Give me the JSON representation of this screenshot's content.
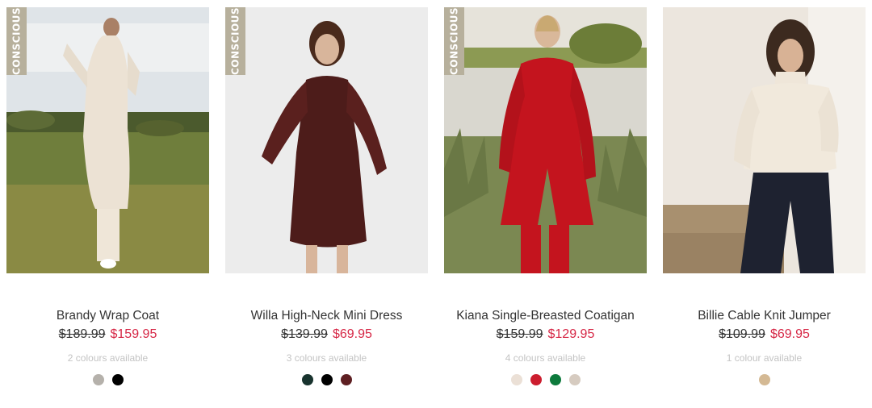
{
  "products": [
    {
      "badge": "CONSCIOUS",
      "name": "Brandy Wrap Coat",
      "was_price": "$189.99",
      "now_price": "$159.95",
      "colours_text": "2 colours available",
      "swatches": [
        "#b5b1ab",
        "#000000"
      ]
    },
    {
      "badge": "CONSCIOUS",
      "name": "Willa High-Neck Mini Dress",
      "was_price": "$139.99",
      "now_price": "$69.95",
      "colours_text": "3 colours available",
      "swatches": [
        "#18332e",
        "#000000",
        "#5e1f22"
      ]
    },
    {
      "badge": "CONSCIOUS",
      "name": "Kiana Single-Breasted Coatigan",
      "was_price": "$159.99",
      "now_price": "$129.95",
      "colours_text": "4 colours available",
      "swatches": [
        "#ebe0d6",
        "#cc1d2e",
        "#0d7a3c",
        "#d6cbc0"
      ]
    },
    {
      "badge": "",
      "name": "Billie Cable Knit Jumper",
      "was_price": "$109.99",
      "now_price": "$69.95",
      "colours_text": "1 colour available",
      "swatches": [
        "#d4b994"
      ]
    }
  ]
}
